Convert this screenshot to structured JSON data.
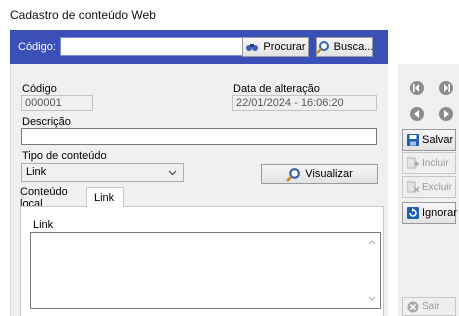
{
  "window": {
    "title": "Cadastro de conteúdo Web"
  },
  "search_bar": {
    "code_label": "Código:",
    "code_value": "",
    "procurar_label": "Procurar",
    "busca_label": "Busca..."
  },
  "form": {
    "codigo_label": "Código",
    "codigo_value": "000001",
    "data_label": "Data de alteração",
    "data_value": "22/01/2024 - 16:06:20",
    "descricao_label": "Descrição",
    "descricao_value": "",
    "tipo_label": "Tipo de conteúdo",
    "tipo_value": "Link",
    "visualizar_label": "Visualizar"
  },
  "tabs": [
    {
      "label": "Conteúdo local",
      "active": false
    },
    {
      "label": "Link",
      "active": true
    }
  ],
  "link_tab": {
    "link_label": "Link",
    "link_value": ""
  },
  "side_buttons": {
    "salvar": "Salvar",
    "incluir": "Incluir",
    "excluir": "Excluir",
    "ignorar": "Ignorar",
    "sair": "Sair"
  },
  "colors": {
    "topbar": "#3a4fb8",
    "accent_blue": "#1e5fb4"
  }
}
